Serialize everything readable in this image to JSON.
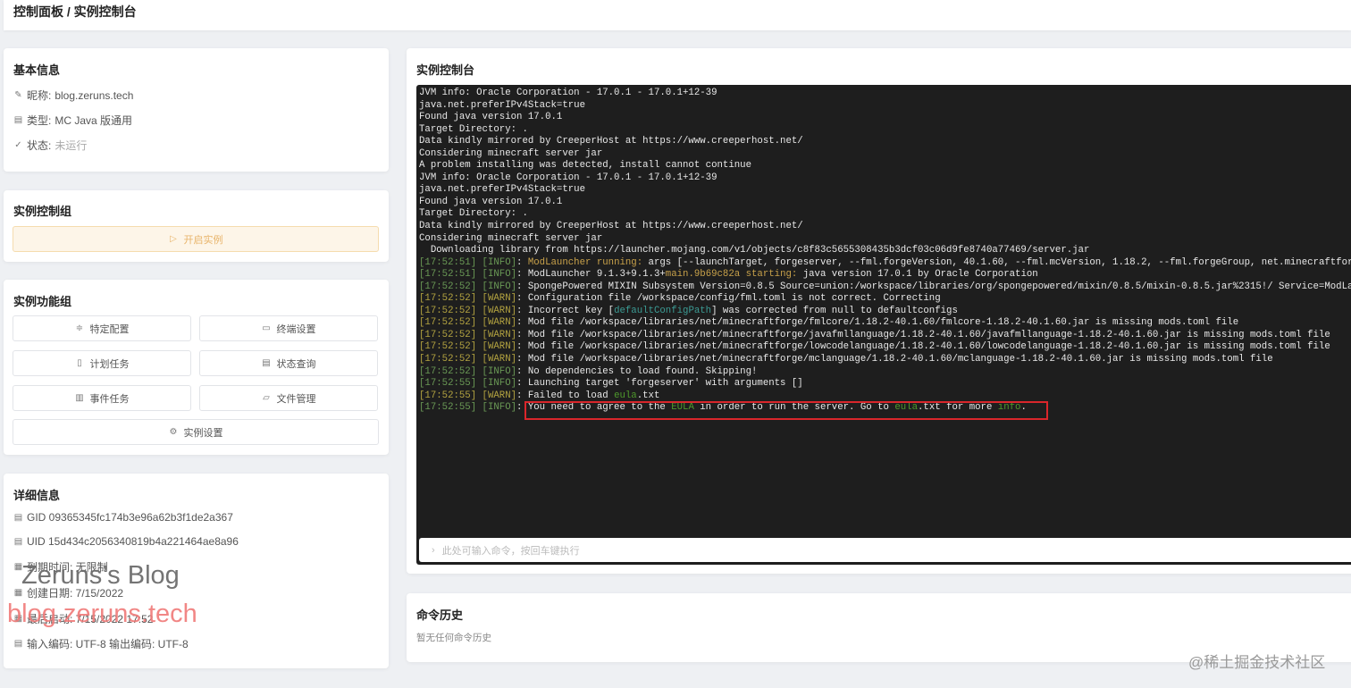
{
  "breadcrumb": "控制面板 / 实例控制台",
  "basic": {
    "title": "基本信息",
    "rows": [
      {
        "icon": "edit-icon",
        "label": "昵称: ",
        "value": "blog.zeruns.tech"
      },
      {
        "icon": "document-icon",
        "label": "类型: ",
        "value": "MC Java 版通用"
      },
      {
        "icon": "status-icon",
        "label": "状态: ",
        "value": "未运行"
      }
    ]
  },
  "control": {
    "title": "实例控制组",
    "start_label": "开启实例"
  },
  "functions": {
    "title": "实例功能组",
    "buttons": [
      {
        "icon": "sliders-icon",
        "label": "特定配置"
      },
      {
        "icon": "monitor-icon",
        "label": "终端设置"
      },
      {
        "icon": "calendar-icon",
        "label": "计划任务"
      },
      {
        "icon": "chart-icon",
        "label": "状态查询"
      },
      {
        "icon": "list-icon",
        "label": "事件任务"
      },
      {
        "icon": "folder-icon",
        "label": "文件管理"
      },
      {
        "icon": "gear-icon",
        "label": "实例设置"
      }
    ]
  },
  "details": {
    "title": "详细信息",
    "rows": [
      "GID 09365345fc174b3e96a62b3f1de2a367",
      "UID 15d434c2056340819b4a221464ae8a96",
      "到期时间: 无限制",
      "创建日期: 7/15/2022",
      "最后启动: 7/15/2022 17:52",
      "输入编码: UTF-8 输出编码: UTF-8"
    ]
  },
  "console": {
    "title": "实例控制台",
    "placeholder": "此处可输入命令，按回车键执行",
    "lines": [
      [
        [
          "JVM info: Oracle Corporation - 17.0.1 - 17.0.1+12-39",
          "w"
        ]
      ],
      [
        [
          "java.net.preferIPv4Stack=true",
          "w"
        ]
      ],
      [
        [
          "Found java version 17.0.1",
          "w"
        ]
      ],
      [
        [
          "Target Directory: .",
          "w"
        ]
      ],
      [
        [
          "Data kindly mirrored by CreeperHost at https://www.creeperhost.net/",
          "w"
        ]
      ],
      [
        [
          "Considering minecraft server jar",
          "w"
        ]
      ],
      [
        [
          "A problem installing was detected, install cannot continue",
          "w"
        ]
      ],
      [
        [
          "JVM info: Oracle Corporation - 17.0.1 - 17.0.1+12-39",
          "w"
        ]
      ],
      [
        [
          "java.net.preferIPv4Stack=true",
          "w"
        ]
      ],
      [
        [
          "Found java version 17.0.1",
          "w"
        ]
      ],
      [
        [
          "Target Directory: .",
          "w"
        ]
      ],
      [
        [
          "Data kindly mirrored by CreeperHost at https://www.creeperhost.net/",
          "w"
        ]
      ],
      [
        [
          "Considering minecraft server jar",
          "w"
        ]
      ],
      [
        [
          "  Downloading library from https://launcher.mojang.com/v1/objects/c8f83c5655308435b3dcf03c06d9fe8740a77469/server.jar",
          "w"
        ]
      ],
      [
        [
          "[17:52:51] [INFO]",
          "tsi"
        ],
        [
          ": ",
          "w"
        ],
        [
          "ModLauncher running:",
          "y"
        ],
        [
          " args [--launchTarget, forgeserver, --fml.forgeVersion, 40.1.60, --fml.mcVersion, 1.18.2, --fml.forgeGroup, net.minecraftforge",
          "w"
        ]
      ],
      [
        [
          "[17:52:51] [INFO]",
          "tsi"
        ],
        [
          ": ModLauncher 9.1.3+9.1.3+",
          "w"
        ],
        [
          "main.9b69c82a starting:",
          "y"
        ],
        [
          " java version 17.0.1 by Oracle Corporation",
          "w"
        ]
      ],
      [
        [
          "[17:52:52] [INFO]",
          "tsi"
        ],
        [
          ": SpongePowered MIXIN Subsystem Version=0.8.5 Source=union:/workspace/libraries/org/spongepowered/mixin/0.8.5/mixin-0.8.5.jar%2315!/ Service=ModLauncher",
          "w"
        ]
      ],
      [
        [
          "[17:52:52] [WARN]",
          "tsw"
        ],
        [
          ": Configuration file /workspace/config/fml.toml is not correct. Correcting",
          "w"
        ]
      ],
      [
        [
          "[17:52:52] [WARN]",
          "tsw"
        ],
        [
          ": Incorrect key [",
          "w"
        ],
        [
          "defaultConfigPath",
          "cy"
        ],
        [
          "] was corrected from null to defaultconfigs",
          "w"
        ]
      ],
      [
        [
          "[17:52:52] [WARN]",
          "tsw"
        ],
        [
          ": Mod file /workspace/libraries/net/minecraftforge/fmlcore/1.18.2-40.1.60/fmlcore-1.18.2-40.1.60.jar is missing mods.toml file",
          "w"
        ]
      ],
      [
        [
          "[17:52:52] [WARN]",
          "tsw"
        ],
        [
          ": Mod file /workspace/libraries/net/minecraftforge/javafmllanguage/1.18.2-40.1.60/javafmllanguage-1.18.2-40.1.60.jar is missing mods.toml file",
          "w"
        ]
      ],
      [
        [
          "[17:52:52] [WARN]",
          "tsw"
        ],
        [
          ": Mod file /workspace/libraries/net/minecraftforge/lowcodelanguage/1.18.2-40.1.60/lowcodelanguage-1.18.2-40.1.60.jar is missing mods.toml file",
          "w"
        ]
      ],
      [
        [
          "[17:52:52] [WARN]",
          "tsw"
        ],
        [
          ": Mod file /workspace/libraries/net/minecraftforge/mclanguage/1.18.2-40.1.60/mclanguage-1.18.2-40.1.60.jar is missing mods.toml file",
          "w"
        ]
      ],
      [
        [
          "[17:52:52] [INFO]",
          "tsi"
        ],
        [
          ": No dependencies to load found. Skipping!",
          "w"
        ]
      ],
      [
        [
          "[17:52:55] [INFO]",
          "tsi"
        ],
        [
          ": Launching target 'forgeserver' with arguments []",
          "w"
        ]
      ],
      [
        [
          "[17:52:55] [WARN]",
          "tsw"
        ],
        [
          ": Failed to load ",
          "w"
        ],
        [
          "eula",
          "g"
        ],
        [
          ".txt",
          "w"
        ]
      ],
      [
        [
          "[17:52:55] [INFO]",
          "tsi"
        ],
        [
          ": You need to agree to the ",
          "w"
        ],
        [
          "EULA",
          "g"
        ],
        [
          " in order to run the server. Go to ",
          "w"
        ],
        [
          "eula",
          "g"
        ],
        [
          ".txt for more ",
          "w"
        ],
        [
          "info",
          "g"
        ],
        [
          ".",
          "w"
        ]
      ]
    ]
  },
  "history": {
    "title": "命令历史",
    "empty": "暂无任何命令历史"
  },
  "watermarks": {
    "blog_name": "Zeruns’s Blog",
    "blog_url": "blog.zeruns.tech",
    "site": "@稀土掘金技术社区"
  },
  "colors": {
    "highlight_border": "#d9262b",
    "start_button": "#e8b46a",
    "console_bg": "#1e1e1e"
  }
}
